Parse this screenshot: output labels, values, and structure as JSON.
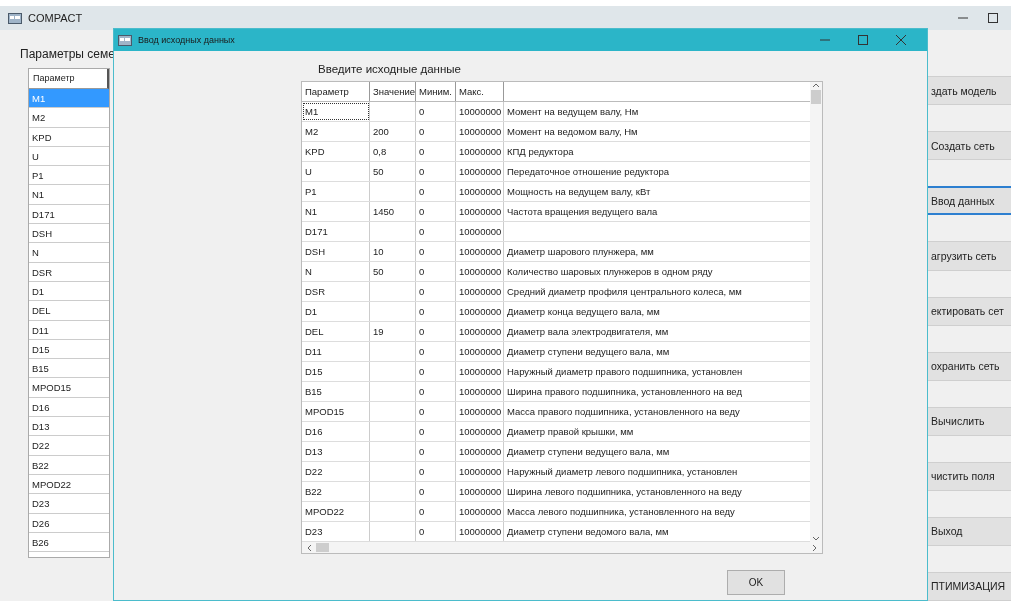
{
  "main_window": {
    "title": "COMPACT",
    "group_label": "Параметры семе",
    "table": {
      "header": "Параметр",
      "rows": [
        {
          "text": "M1",
          "selected": true
        },
        {
          "text": "M2",
          "selected": false
        },
        {
          "text": "KPD",
          "selected": false
        },
        {
          "text": "U",
          "selected": false
        },
        {
          "text": "P1",
          "selected": false
        },
        {
          "text": "N1",
          "selected": false
        },
        {
          "text": "D171",
          "selected": false
        },
        {
          "text": "DSH",
          "selected": false
        },
        {
          "text": "N",
          "selected": false
        },
        {
          "text": "DSR",
          "selected": false
        },
        {
          "text": "D1",
          "selected": false
        },
        {
          "text": "DEL",
          "selected": false
        },
        {
          "text": "D11",
          "selected": false
        },
        {
          "text": "D15",
          "selected": false
        },
        {
          "text": "B15",
          "selected": false
        },
        {
          "text": "MPOD15",
          "selected": false
        },
        {
          "text": "D16",
          "selected": false
        },
        {
          "text": "D13",
          "selected": false
        },
        {
          "text": "D22",
          "selected": false
        },
        {
          "text": "B22",
          "selected": false
        },
        {
          "text": "MPOD22",
          "selected": false
        },
        {
          "text": "D23",
          "selected": false
        },
        {
          "text": "D26",
          "selected": false
        },
        {
          "text": "B26",
          "selected": false
        }
      ]
    },
    "buttons": [
      {
        "label": "здать модель",
        "focused": false
      },
      {
        "label": "Создать сеть",
        "focused": false
      },
      {
        "label": "Ввод данных",
        "focused": true
      },
      {
        "label": "агрузить сеть",
        "focused": false
      },
      {
        "label": "ектировать сет",
        "focused": false
      },
      {
        "label": "охранить сеть",
        "focused": false
      },
      {
        "label": "Вычислить",
        "focused": false
      },
      {
        "label": "чистить поля",
        "focused": false
      },
      {
        "label": "Выход",
        "focused": false
      },
      {
        "label": "ПТИМИЗАЦИЯ",
        "focused": false
      }
    ]
  },
  "dialog": {
    "title": "Ввод исходных данных",
    "prompt": "Введите исходные данные",
    "table": {
      "columns": [
        "Параметр",
        "Значение",
        "Миним.",
        "Макс."
      ],
      "rows": [
        {
          "param": "M1",
          "value": "",
          "min": "0",
          "max": "10000000",
          "description": "Момент на ведущем валу, Нм"
        },
        {
          "param": "M2",
          "value": "200",
          "min": "0",
          "max": "10000000",
          "description": "Момент на ведомом валу, Нм"
        },
        {
          "param": "KPD",
          "value": "0,8",
          "min": "0",
          "max": "10000000",
          "description": "КПД редуктора"
        },
        {
          "param": "U",
          "value": "50",
          "min": "0",
          "max": "10000000",
          "description": "Передаточное отношение редуктора"
        },
        {
          "param": "P1",
          "value": "",
          "min": "0",
          "max": "10000000",
          "description": "Мощность на ведущем валу, кВт"
        },
        {
          "param": "N1",
          "value": "1450",
          "min": "0",
          "max": "10000000",
          "description": "Частота вращения ведущего вала"
        },
        {
          "param": "D171",
          "value": "",
          "min": "0",
          "max": "10000000",
          "description": ""
        },
        {
          "param": "DSH",
          "value": "10",
          "min": "0",
          "max": "10000000",
          "description": "Диаметр шарового плунжера, мм"
        },
        {
          "param": "N",
          "value": "50",
          "min": "0",
          "max": "10000000",
          "description": "Количество шаровых плунжеров в одном ряду"
        },
        {
          "param": "DSR",
          "value": "",
          "min": "0",
          "max": "10000000",
          "description": "Средний диаметр профиля центрального колеса, мм"
        },
        {
          "param": "D1",
          "value": "",
          "min": "0",
          "max": "10000000",
          "description": "Диаметр конца ведущего вала, мм"
        },
        {
          "param": "DEL",
          "value": "19",
          "min": "0",
          "max": "10000000",
          "description": "Диаметр вала электродвигателя, мм"
        },
        {
          "param": "D11",
          "value": "",
          "min": "0",
          "max": "10000000",
          "description": "Диаметр ступени ведущего вала, мм"
        },
        {
          "param": "D15",
          "value": "",
          "min": "0",
          "max": "10000000",
          "description": "Наружный диаметр правого подшипника, установлен"
        },
        {
          "param": "B15",
          "value": "",
          "min": "0",
          "max": "10000000",
          "description": "Ширина правого подшипника, установленного на вед"
        },
        {
          "param": "MPOD15",
          "value": "",
          "min": "0",
          "max": "10000000",
          "description": "Масса правого подшипника, установленного на веду"
        },
        {
          "param": "D16",
          "value": "",
          "min": "0",
          "max": "10000000",
          "description": "Диаметр правой крышки, мм"
        },
        {
          "param": "D13",
          "value": "",
          "min": "0",
          "max": "10000000",
          "description": "Диаметр ступени ведущего вала, мм"
        },
        {
          "param": "D22",
          "value": "",
          "min": "0",
          "max": "10000000",
          "description": "Наружный диаметр левого подшипника, установлен"
        },
        {
          "param": "B22",
          "value": "",
          "min": "0",
          "max": "10000000",
          "description": "Ширина левого подшипника, установленного на веду"
        },
        {
          "param": "MPOD22",
          "value": "",
          "min": "0",
          "max": "10000000",
          "description": "Масса левого подшипника, установленного на веду"
        },
        {
          "param": "D23",
          "value": "",
          "min": "0",
          "max": "10000000",
          "description": "Диаметр ступени ведомого вала, мм"
        }
      ]
    },
    "ok_button": "OK"
  }
}
